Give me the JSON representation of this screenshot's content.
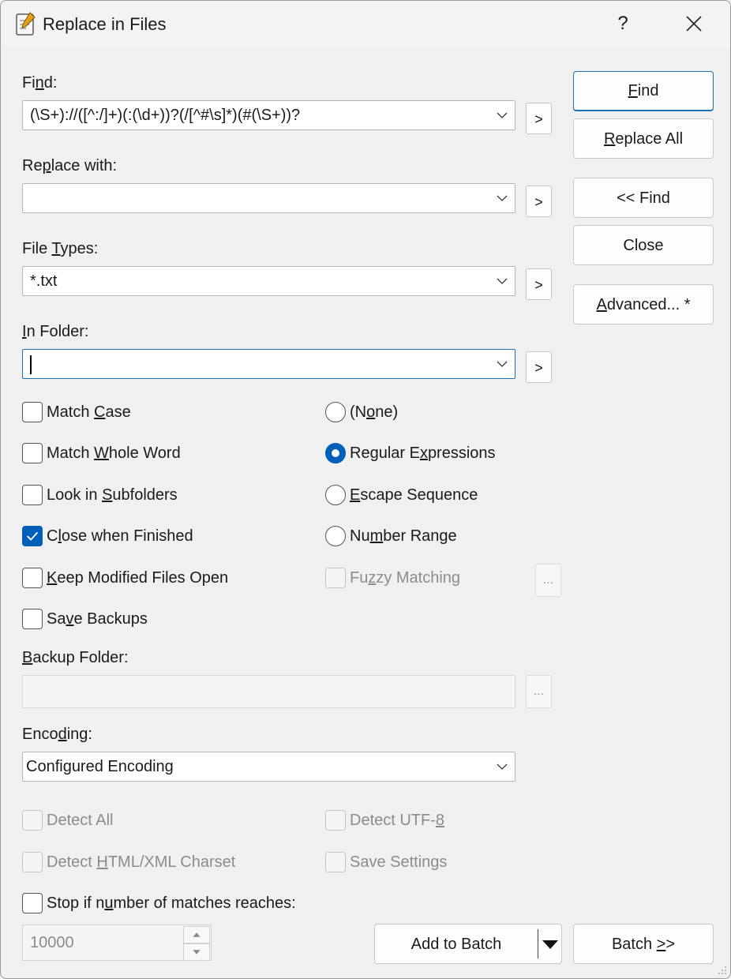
{
  "window": {
    "title": "Replace in Files",
    "help_label": "?"
  },
  "find": {
    "label_pre": "Fi",
    "label_u": "n",
    "label_post": "d:",
    "value": "(\\S+)://([^:/]+)(:(\\d+))?(/[^#\\s]*)(#(\\S+))?",
    "arrow": ">"
  },
  "replace": {
    "label_pre": "Re",
    "label_u": "p",
    "label_post": "lace with:",
    "value": "",
    "arrow": ">"
  },
  "file_types": {
    "label_pre": "File ",
    "label_u": "T",
    "label_post": "ypes:",
    "value": "*.txt",
    "arrow": ">"
  },
  "in_folder": {
    "label_pre": "",
    "label_u": "I",
    "label_post": "n Folder:",
    "value": "",
    "arrow": ">"
  },
  "buttons": {
    "find_u": "F",
    "find_rest": "ind",
    "replace_all_u": "R",
    "replace_all_rest": "eplace All",
    "collapse_find": "<< Find",
    "close": "Close",
    "advanced_u": "A",
    "advanced_rest": "dvanced... *",
    "add_to_batch": "Add to Batch",
    "batch_pre": "Batch ",
    "batch_u": ">",
    "batch_post": ">"
  },
  "options_left": [
    {
      "pre": "Match ",
      "u": "C",
      "post": "ase",
      "checked": false,
      "enabled": true
    },
    {
      "pre": "Match ",
      "u": "W",
      "post": "hole Word",
      "checked": false,
      "enabled": true
    },
    {
      "pre": "Look in ",
      "u": "S",
      "post": "ubfolders",
      "checked": false,
      "enabled": true
    },
    {
      "pre": "C",
      "u": "l",
      "post": "ose when Finished",
      "checked": true,
      "enabled": true
    },
    {
      "pre": "",
      "u": "K",
      "post": "eep Modified Files Open",
      "checked": false,
      "enabled": true
    },
    {
      "pre": "Sa",
      "u": "v",
      "post": "e Backups",
      "checked": false,
      "enabled": true
    }
  ],
  "options_right": [
    {
      "pre": "(N",
      "u": "o",
      "post": "ne)",
      "selected": false
    },
    {
      "pre": "Regular E",
      "u": "x",
      "post": "pressions",
      "selected": true
    },
    {
      "pre": "",
      "u": "E",
      "post": "scape Sequence",
      "selected": false
    },
    {
      "pre": "Nu",
      "u": "m",
      "post": "ber Range",
      "selected": false
    }
  ],
  "fuzzy": {
    "pre": "Fu",
    "u": "z",
    "post": "zy Matching",
    "checked": false,
    "enabled": false,
    "dots": "..."
  },
  "backup_folder": {
    "label_pre": "",
    "label_u": "B",
    "label_post": "ackup Folder:",
    "value": "",
    "dots": "..."
  },
  "encoding": {
    "label_pre": "Enco",
    "label_u": "d",
    "label_post": "ing:",
    "value": "Configured Encoding"
  },
  "detect": {
    "all": "Detect All",
    "utf8_pre": "Detect UTF-",
    "utf8_u": "8",
    "html_pre": "Detect ",
    "html_u": "H",
    "html_post": "TML/XML Charset",
    "save_pre": "Save Settin",
    "save_u": "g",
    "save_post": "s"
  },
  "stop": {
    "pre": "Stop if n",
    "u": "u",
    "post": "mber of matches reaches:",
    "checked": false,
    "value": "10000"
  }
}
